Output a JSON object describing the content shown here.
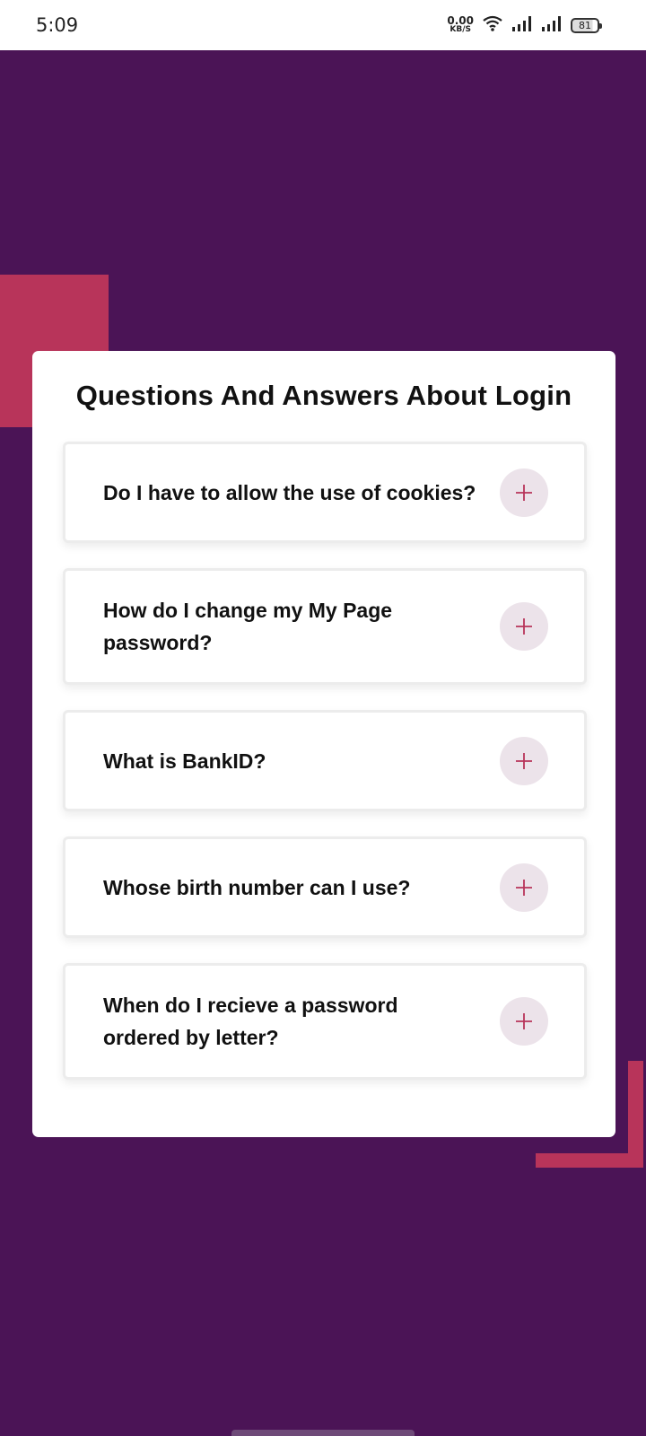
{
  "status": {
    "time": "5:09",
    "net_speed_value": "0.00",
    "net_speed_unit": "KB/S",
    "battery": "81",
    "icons": [
      "wifi-icon",
      "signal-icon",
      "signal-icon",
      "battery-icon"
    ]
  },
  "colors": {
    "background": "#4b1456",
    "accent": "#b8345a",
    "card": "#ffffff",
    "plus_bg": "#ece3ea"
  },
  "faq": {
    "title": "Questions And Answers About Login",
    "items": [
      {
        "question": "Do I have to allow the use of cookies?",
        "icon": "plus-icon"
      },
      {
        "question": "How do I change my My Page password?",
        "icon": "plus-icon"
      },
      {
        "question": "What is BankID?",
        "icon": "plus-icon"
      },
      {
        "question": "Whose birth number can I use?",
        "icon": "plus-icon"
      },
      {
        "question": "When do I recieve a password ordered by letter?",
        "icon": "plus-icon"
      }
    ]
  }
}
